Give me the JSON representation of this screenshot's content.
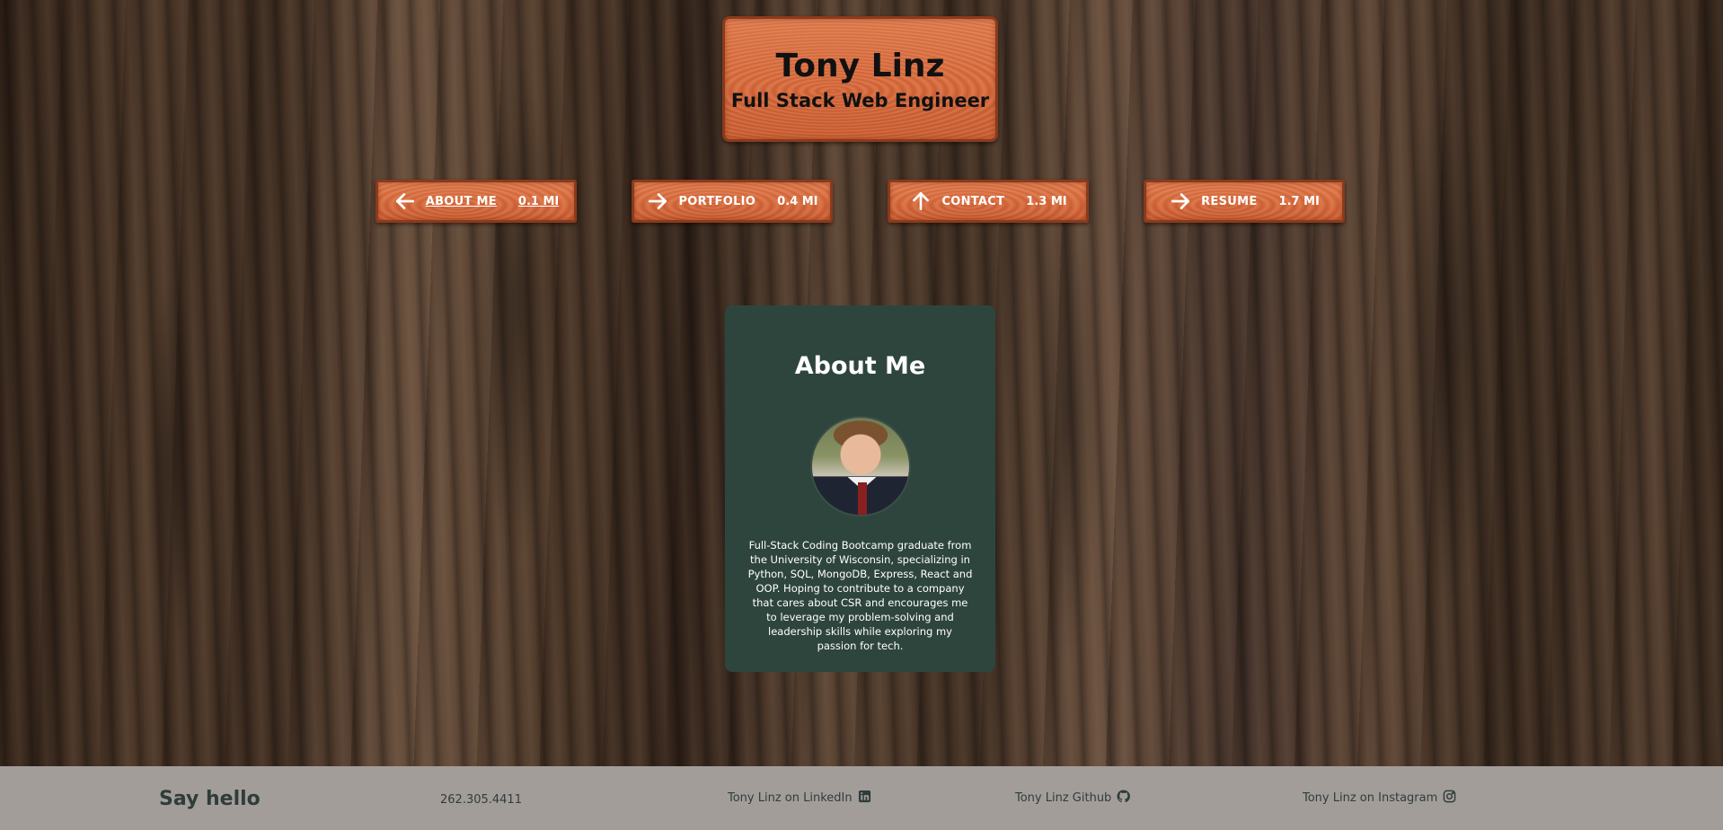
{
  "header": {
    "name": "Tony Linz",
    "role": "Full Stack Web Engineer"
  },
  "nav": [
    {
      "label": "ABOUT ME",
      "distance": "0.1 MI",
      "icon": "arrow-left-icon"
    },
    {
      "label": "PORTFOLIO",
      "distance": "0.4 MI",
      "icon": "arrow-right-icon"
    },
    {
      "label": "CONTACT",
      "distance": "1.3 MI",
      "icon": "arrow-up-icon"
    },
    {
      "label": "RESUME",
      "distance": "1.7 MI",
      "icon": "arrow-right-icon"
    }
  ],
  "about": {
    "title": "About Me",
    "bio": "Full-Stack Coding Bootcamp graduate from the University of Wisconsin, specializing in Python, SQL, MongoDB, Express, React and OOP. Hoping to contribute to a company that cares about CSR and encourages me to leverage my problem-solving and leadership skills while exploring my passion for tech."
  },
  "footer": {
    "say_hello": "Say hello",
    "phone": "262.305.4411",
    "linkedin": "Tony Linz on LinkedIn",
    "github": "Tony Linz Github",
    "instagram": "Tony Linz on Instagram"
  },
  "colors": {
    "sign_wood": "#d8693b",
    "card_bg": "#2e453d",
    "footer_bg": "#a39d9a",
    "footer_text": "#2f3d3a"
  }
}
